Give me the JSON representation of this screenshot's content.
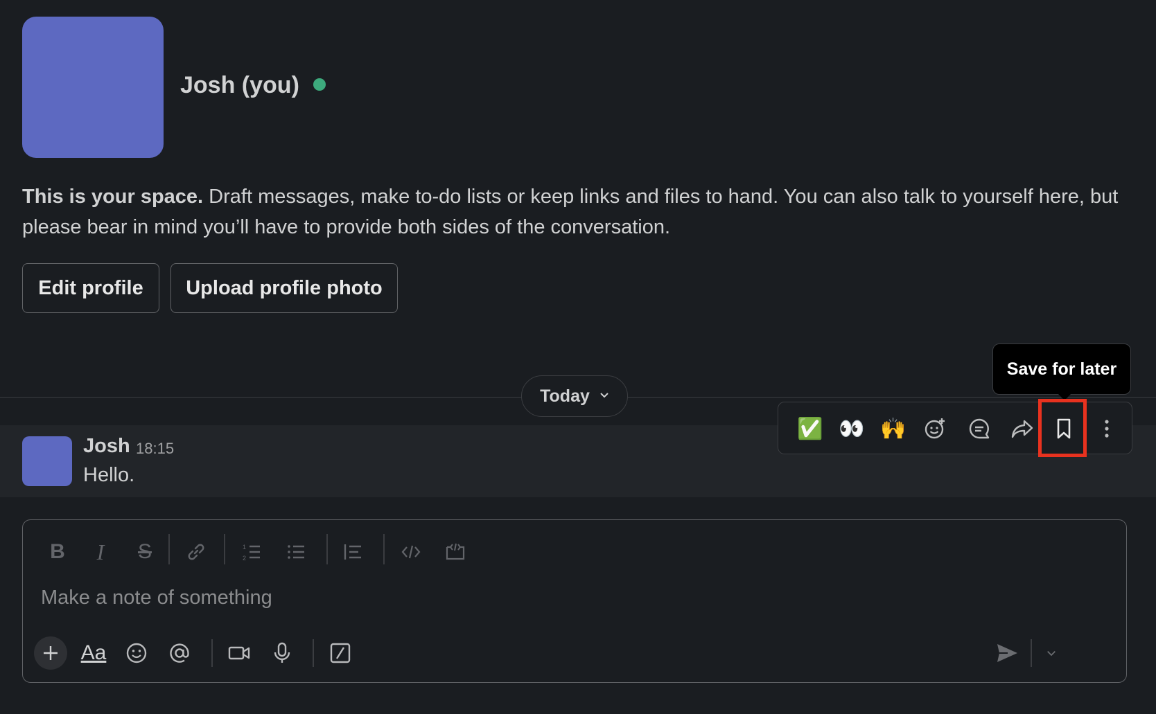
{
  "profile": {
    "name": "Josh (you)",
    "presence": "active",
    "intro_bold": "This is your space.",
    "intro_text": " Draft messages, make to-do lists or keep links and files to hand. You can also talk to yourself here, but please bear in mind you’ll have to provide both sides of the conversation.",
    "edit_button": "Edit profile",
    "upload_button": "Upload profile photo",
    "avatar_color": "#5d69c1"
  },
  "divider": {
    "label": "Today"
  },
  "message": {
    "author": "Josh",
    "time": "18:15",
    "text": "Hello."
  },
  "actions": {
    "tooltip": "Save for later",
    "items": [
      {
        "name": "react-check-emoji",
        "glyph": "✅"
      },
      {
        "name": "react-eyes-emoji",
        "glyph": "👀"
      },
      {
        "name": "react-raised-hands-emoji",
        "glyph": "🙌"
      },
      {
        "name": "add-reaction-icon"
      },
      {
        "name": "reply-in-thread-icon"
      },
      {
        "name": "forward-message-icon"
      },
      {
        "name": "bookmark-icon"
      },
      {
        "name": "more-actions-icon"
      }
    ],
    "highlight_color": "#e8321f"
  },
  "composer": {
    "placeholder": "Make a note of something",
    "format_tools": [
      "bold-icon",
      "italic-icon",
      "strikethrough-icon",
      "link-icon",
      "ordered-list-icon",
      "bulleted-list-icon",
      "blockquote-icon",
      "code-icon",
      "code-block-icon"
    ],
    "bottom_tools": [
      "plus-icon",
      "formatting-icon",
      "emoji-icon",
      "mention-icon",
      "video-clip-icon",
      "audio-clip-icon",
      "shortcuts-icon",
      "send-icon",
      "schedule-chevron-icon"
    ],
    "format_label": "Aa"
  }
}
